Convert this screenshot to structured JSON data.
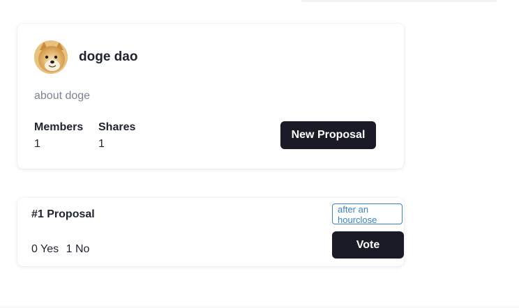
{
  "dao": {
    "name": "doge dao",
    "description": "about doge",
    "stats": {
      "members_label": "Members",
      "members_value": "1",
      "shares_label": "Shares",
      "shares_value": "1"
    },
    "new_proposal_label": "New Proposal"
  },
  "proposal": {
    "title": "#1 Proposal",
    "yes_text": "0 Yes",
    "no_text": "1 No",
    "status_text": "after an hourclose",
    "vote_label": "Vote"
  },
  "colors": {
    "button_bg": "#1a1b27",
    "badge_accent": "#3b82c4",
    "muted_text": "#7a8394"
  },
  "icons": {
    "avatar": "doge-avatar-icon"
  }
}
